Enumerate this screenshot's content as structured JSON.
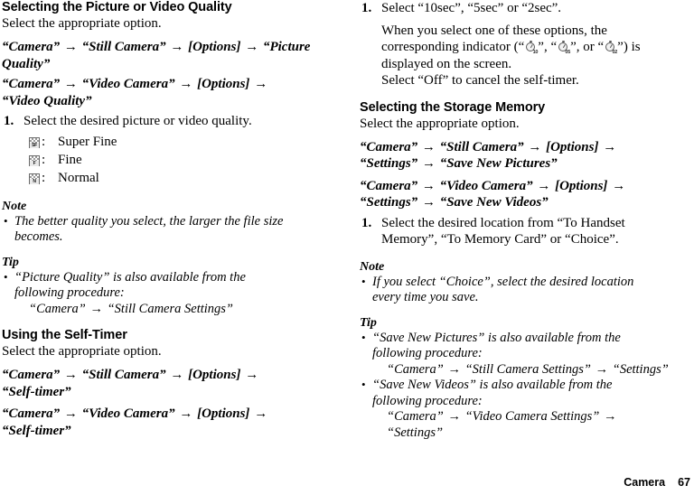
{
  "footer": {
    "chapter": "Camera",
    "page_number": "67"
  },
  "left_column": {
    "section1": {
      "heading": "Selecting the Picture or Video Quality",
      "intro": "Select the appropriate option.",
      "path1": {
        "part1": "“Camera”",
        "arrow1": "→",
        "part2": "“Still Camera”",
        "arrow2": "→",
        "part3": "[Options]",
        "arrow3": "→",
        "part4": "“Picture Quality”"
      },
      "path2": {
        "part1": "“Camera”",
        "arrow1": "→",
        "part2": "“Video Camera”",
        "arrow2": "→",
        "part3": "[Options]",
        "arrow3": "→",
        "part4": "“Video Quality”"
      },
      "step1_num": "1.",
      "step1_text": "Select the desired picture or video quality.",
      "legend": [
        {
          "icon": "super-fine-quality-icon",
          "icon_letter": "SF",
          "colon": ":",
          "label": "Super Fine"
        },
        {
          "icon": "fine-quality-icon",
          "icon_letter": "F",
          "colon": ":",
          "label": "Fine"
        },
        {
          "icon": "normal-quality-icon",
          "icon_letter": "N",
          "colon": ":",
          "label": "Normal"
        }
      ],
      "note": {
        "title": "Note",
        "bullet_char": "•",
        "line1": "The better quality you select, the larger the file size",
        "line2": "becomes."
      },
      "tip": {
        "title": "Tip",
        "bullet_char": "•",
        "line1": "“Picture Quality” is also available from the",
        "line2": "following procedure:",
        "line3_part1": "“Camera”",
        "line3_arrow": "→",
        "line3_part2": "“Still Camera Settings”"
      }
    },
    "section2": {
      "heading": "Using the Self-Timer",
      "intro": "Select the appropriate option.",
      "path1": {
        "part1": "“Camera”",
        "arrow1": "→",
        "part2": "“Still Camera”",
        "arrow2": "→",
        "part3": "[Options]",
        "arrow3": "→",
        "part4": "“Self-timer”"
      },
      "path2": {
        "part1": "“Camera”",
        "arrow1": "→",
        "part2": "“Video Camera”",
        "arrow2": "→",
        "part3": "[Options]",
        "arrow3": "→",
        "part4": "“Self-timer”"
      }
    }
  },
  "right_column": {
    "section1_continued": {
      "step1_num": "1.",
      "step1_text": "Select “10sec”, “5sec” or “2sec”.",
      "para_line1": "When you select one of these options, the",
      "para_line2_pre": "corresponding indicator (“",
      "indicator1": {
        "icon": "self-timer-10sec-icon",
        "sub": "10"
      },
      "para_line2_mid1": "”, “",
      "indicator2": {
        "icon": "self-timer-05sec-icon",
        "sub": "05"
      },
      "para_line2_mid2": "”, or “",
      "indicator3": {
        "icon": "self-timer-02sec-icon",
        "sub": "02"
      },
      "para_line2_post": "”) is",
      "para_line3": "displayed on the screen.",
      "para_line4": "Select “Off” to cancel the self-timer."
    },
    "section2": {
      "heading": "Selecting the Storage Memory",
      "intro": "Select the appropriate option.",
      "path1": {
        "part1": "“Camera”",
        "arrow1": "→",
        "part2": "“Still Camera”",
        "arrow2": "→",
        "part3": "[Options]",
        "arrow3": "→",
        "part4": "“Settings”",
        "arrow4": "→",
        "part5": "“Save New Pictures”"
      },
      "path2": {
        "part1": "“Camera”",
        "arrow1": "→",
        "part2": "“Video Camera”",
        "arrow2": "→",
        "part3": "[Options]",
        "arrow3": "→",
        "part4": "“Settings”",
        "arrow4": "→",
        "part5": "“Save New Videos”"
      },
      "step1_num": "1.",
      "step1_line1": "Select the desired location from “To Handset",
      "step1_line2": "Memory”, “To Memory Card” or “Choice”.",
      "note": {
        "title": "Note",
        "bullet_char": "•",
        "line1": "If you select “Choice”, select the desired location",
        "line2": "every time you save."
      },
      "tip": {
        "title": "Tip",
        "bullet_char": "•",
        "item1_line1": "“Save New Pictures” is also available from the",
        "item1_line2": "following procedure:",
        "item1_line3_part1": "“Camera”",
        "item1_line3_arrow1": "→",
        "item1_line3_part2": "“Still Camera Settings”",
        "item1_line3_arrow2": "→",
        "item1_line3_part3": "“Settings”",
        "item2_line1": "“Save New Videos” is also available from the",
        "item2_line2": "following procedure:",
        "item2_line3_part1": "“Camera”",
        "item2_line3_arrow1": "→",
        "item2_line3_part2": "“Video Camera Settings”",
        "item2_line3_arrow2": "→",
        "item2_line4": "“Settings”"
      }
    }
  }
}
